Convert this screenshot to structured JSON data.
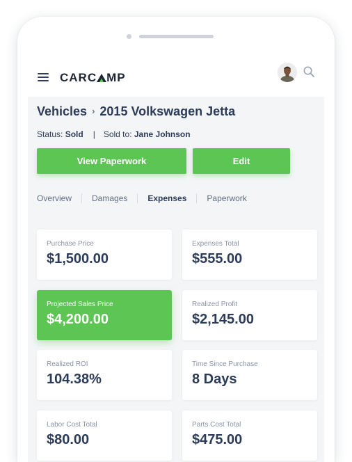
{
  "app": {
    "logo_text_a": "CARC",
    "logo_text_b": "MP"
  },
  "header": {
    "menu_icon": "hamburger-menu-icon",
    "avatar_icon": "user-avatar",
    "search_icon": "search-icon"
  },
  "breadcrumb": {
    "root": "Vehicles",
    "separator": "›",
    "current": "2015 Volkswagen Jetta"
  },
  "status": {
    "status_label": "Status:",
    "status_value": "Sold",
    "pipe": "|",
    "sold_to_label": "Sold to:",
    "sold_to_value": "Jane Johnson"
  },
  "actions": {
    "view_paperwork": "View Paperwork",
    "edit": "Edit"
  },
  "tabs": [
    {
      "label": "Overview",
      "active": false
    },
    {
      "label": "Damages",
      "active": false
    },
    {
      "label": "Expenses",
      "active": true
    },
    {
      "label": "Paperwork",
      "active": false
    }
  ],
  "cards": [
    {
      "label": "Purchase Price",
      "value": "$1,500.00"
    },
    {
      "label": "Expenses Total",
      "value": "$555.00"
    },
    {
      "label": "Projected Sales Price",
      "value": "$4,200.00",
      "highlight": true
    },
    {
      "label": "Realized Profit",
      "value": "$2,145.00"
    },
    {
      "label": "Realized ROI",
      "value": "104.38%"
    },
    {
      "label": "Time Since Purchase",
      "value": "8 Days"
    },
    {
      "label": "Labor Cost Total",
      "value": "$80.00"
    },
    {
      "label": "Parts Cost Total",
      "value": "$475.00"
    }
  ],
  "colors": {
    "accent_green": "#5cc554",
    "text_dark": "#2c3c58",
    "text_muted": "#8a94a6",
    "content_bg": "#f4f5f7"
  }
}
